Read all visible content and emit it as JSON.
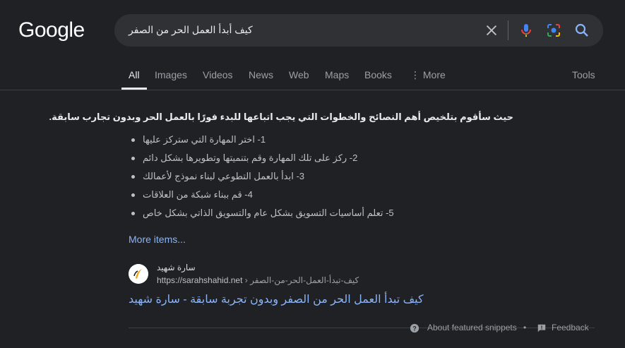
{
  "logo": "Google",
  "search": {
    "query": "كيف أبدأ العمل الحر من الصفر"
  },
  "tabs": [
    {
      "label": "All"
    },
    {
      "label": "Images"
    },
    {
      "label": "Videos"
    },
    {
      "label": "News"
    },
    {
      "label": "Web"
    },
    {
      "label": "Maps"
    },
    {
      "label": "Books"
    },
    {
      "label": "More"
    }
  ],
  "tools_label": "Tools",
  "snippet": {
    "heading": "حيث سأقوم بتلخيص أهم النصائح والخطوات التي يجب اتباعها للبدء فورًا بالعمل الحر وبدون تجارب سابقة.",
    "items": [
      "1- اختر المهارة التي ستركز عليها",
      "2- ركز على تلك المهارة وقم بتنميتها وتطويرها بشكل دائم",
      "3- ابدأ بالعمل التطوعي لبناء نموذج لأعمالك",
      "4- قم ببناء شبكة من العلاقات",
      "5- تعلم أساسيات التسويق بشكل عام والتسويق الذاتي بشكل خاص"
    ],
    "more_items": "More items..."
  },
  "result": {
    "site_name": "سارة شهيد",
    "url": "https://sarahshahid.net",
    "url_path": "› كيف-تبدأ-العمل-الحر-من-الصفر",
    "title": "كيف تبدأ العمل الحر من الصفر وبدون تجربة سابقة - سارة شهيد"
  },
  "footer": {
    "about_label": "About featured snippets",
    "separator": "•",
    "feedback_label": "Feedback"
  },
  "colors": {
    "background": "#202124",
    "link": "#8ab4f8",
    "text": "#e8eaed",
    "muted": "#9aa0a6"
  }
}
